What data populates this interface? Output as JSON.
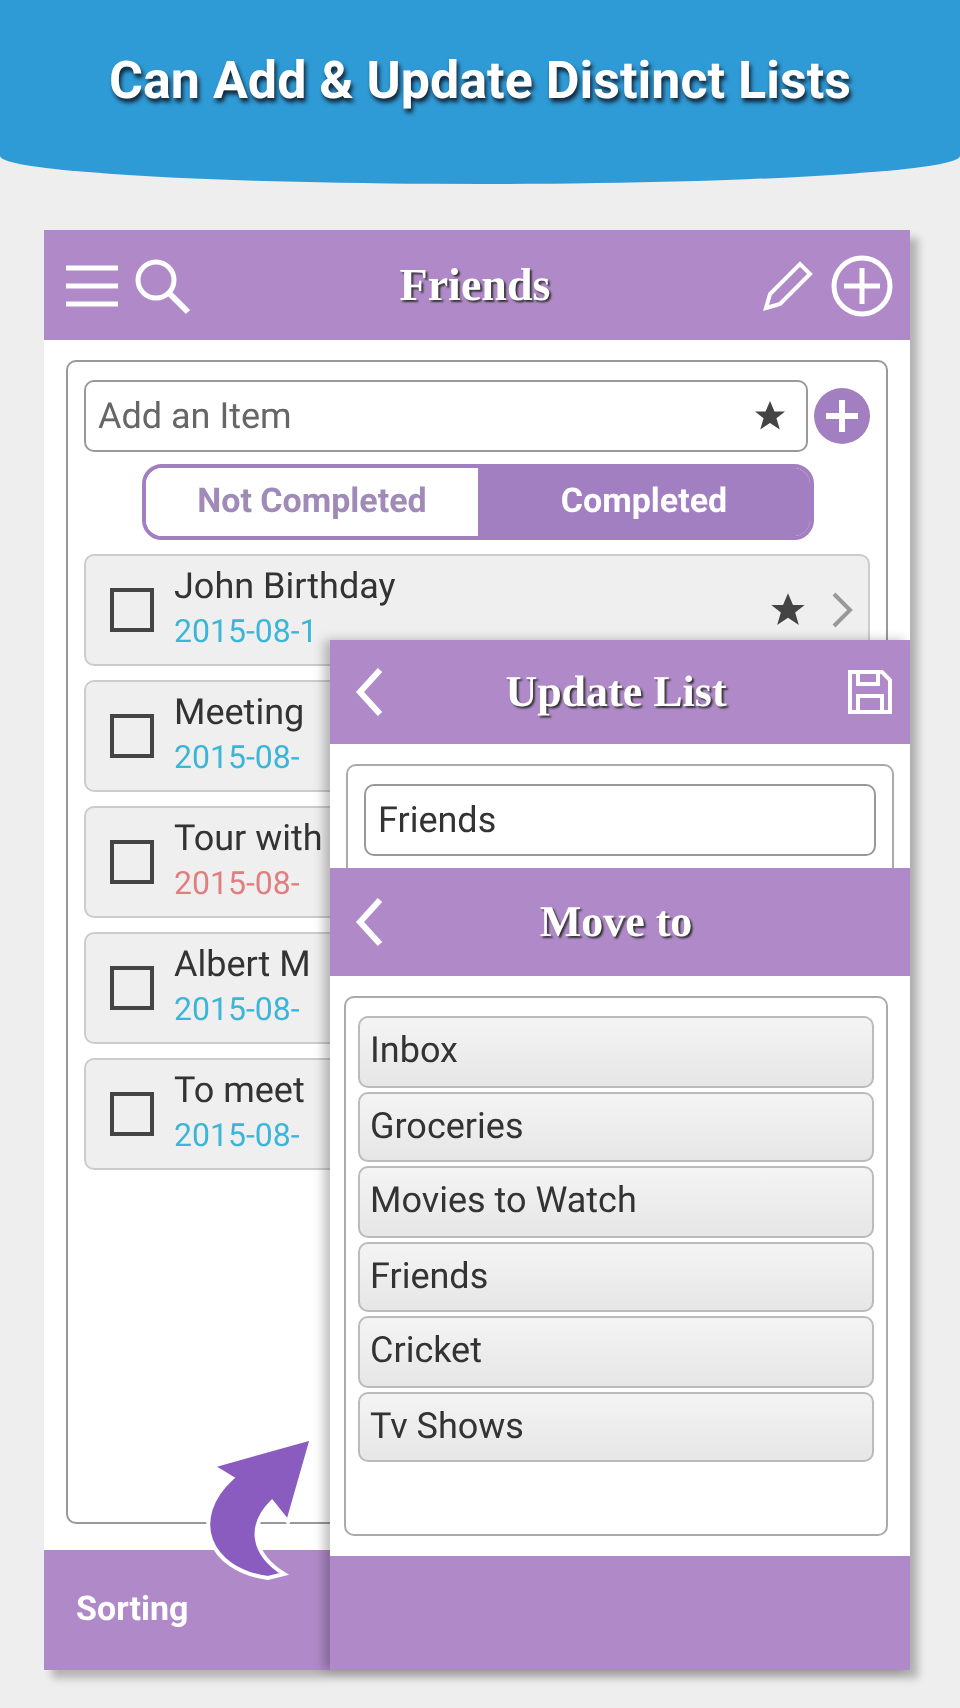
{
  "banner": {
    "title": "Can Add & Update Distinct Lists"
  },
  "app_bar": {
    "title": "Friends"
  },
  "add_item": {
    "placeholder": "Add an Item"
  },
  "tabs": [
    {
      "label": "Not Completed",
      "selected": false
    },
    {
      "label": "Completed",
      "selected": true
    }
  ],
  "tasks": [
    {
      "title": "John Birthday",
      "date": "2015-08-1",
      "color": "#3bb5d8",
      "checked": false,
      "starred": true
    },
    {
      "title": "Meeting",
      "date": "2015-08-",
      "color": "#3bb5d8",
      "checked": false,
      "starred": false
    },
    {
      "title": "Tour with",
      "date": "2015-08-",
      "color": "#e07f7f",
      "checked": false,
      "starred": false
    },
    {
      "title": "Albert M",
      "date": "2015-08-",
      "color": "#3bb5d8",
      "checked": false,
      "starred": false
    },
    {
      "title": "To meet",
      "date": "2015-08-",
      "color": "#3bb5d8",
      "checked": false,
      "starred": false
    }
  ],
  "update_list": {
    "title": "Update List",
    "value": "Friends"
  },
  "move_to": {
    "title": "Move to",
    "lists": [
      "Inbox",
      "Groceries",
      "Movies to Watch",
      "Friends",
      "Cricket",
      "Tv Shows"
    ]
  },
  "bottom_bar": {
    "label": "Sorting"
  }
}
